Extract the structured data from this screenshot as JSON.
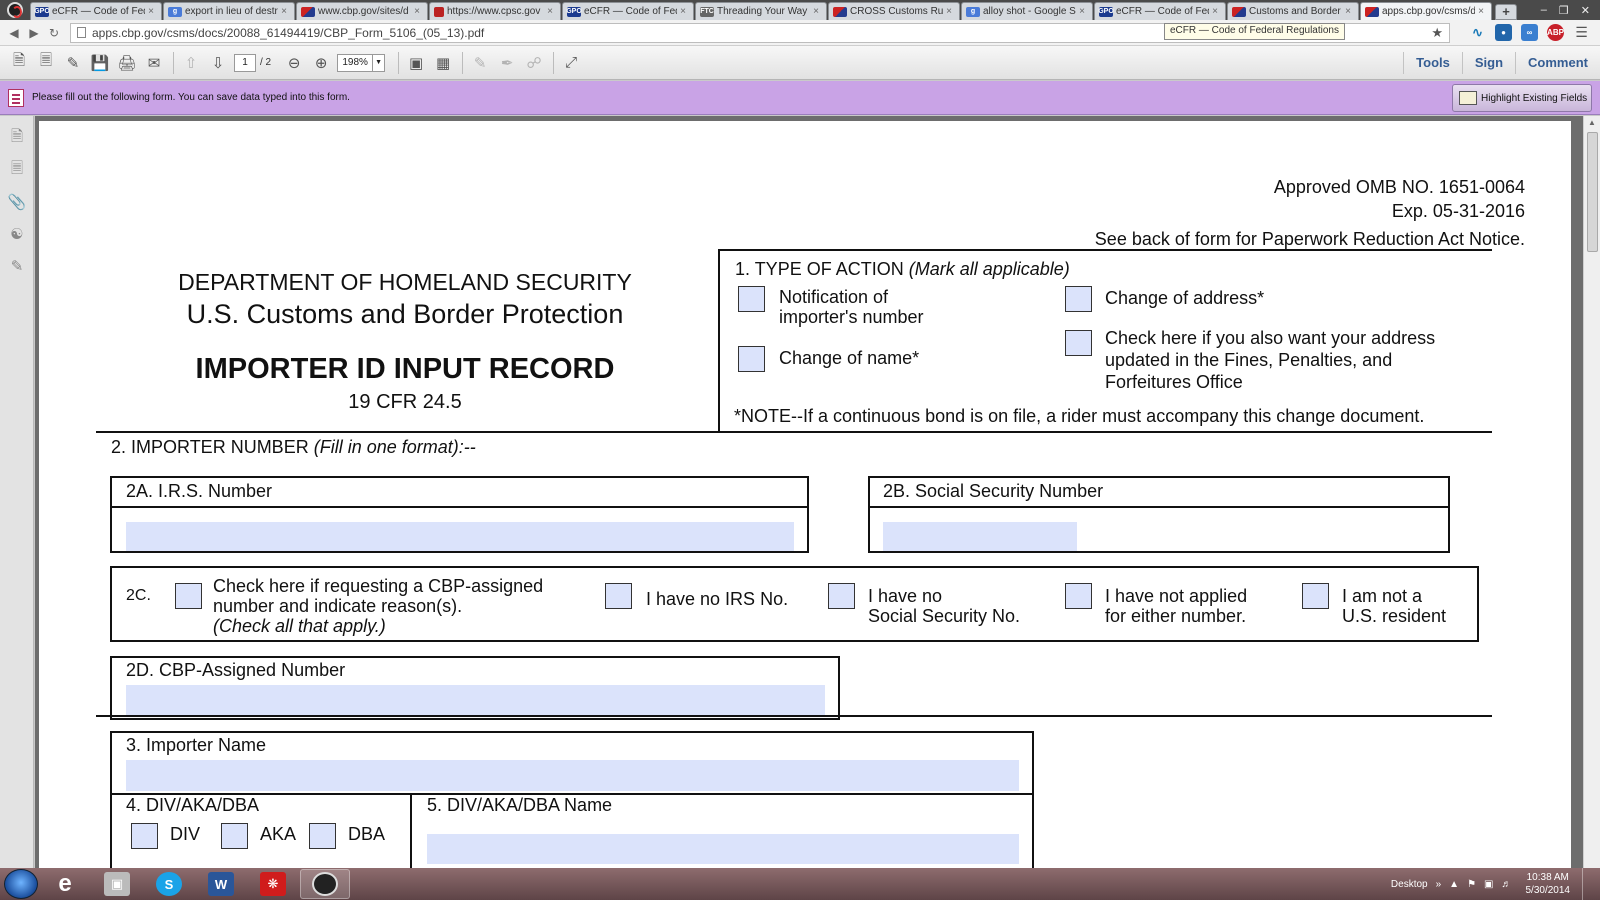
{
  "browser": {
    "tabs": [
      {
        "label": "eCFR — Code of Fed",
        "favicon": "gpo"
      },
      {
        "label": "export in lieu of destr",
        "favicon": "google"
      },
      {
        "label": "www.cbp.gov/sites/d",
        "favicon": "flag"
      },
      {
        "label": "https://www.cpsc.gov",
        "favicon": "cpsc"
      },
      {
        "label": "eCFR — Code of Fed",
        "favicon": "gpo"
      },
      {
        "label": "Threading Your Way",
        "favicon": "ftc"
      },
      {
        "label": "CROSS Customs Rulin",
        "favicon": "flag"
      },
      {
        "label": "alloy shot - Google S",
        "favicon": "google"
      },
      {
        "label": "eCFR — Code of Fed",
        "favicon": "gpo"
      },
      {
        "label": "Customs and Border",
        "favicon": "flag"
      },
      {
        "label": "apps.cbp.gov/csms/d",
        "favicon": "flag",
        "active": true
      }
    ],
    "url": "apps.cbp.gov/csms/docs/20088_61494419/CBP_Form_5106_(05_13).pdf",
    "hover_tooltip": "eCFR — Code of Federal Regulations"
  },
  "viewer": {
    "page_current": "1",
    "page_total": "/ 2",
    "zoom": "198%",
    "links": [
      "Tools",
      "Sign",
      "Comment"
    ],
    "form_notice": "Please fill out the following form. You can save data typed into this form.",
    "highlight_button": "Highlight Existing Fields"
  },
  "form": {
    "omb_line1": "Approved OMB NO. 1651-0064",
    "omb_line2": "Exp. 05-31-2016",
    "paperwork": "See back of form for Paperwork Reduction Act Notice.",
    "dept": "DEPARTMENT OF HOMELAND SECURITY",
    "agency": "U.S. Customs and Border Protection",
    "title": "IMPORTER ID INPUT RECORD",
    "cfr": "19 CFR 24.5",
    "s1_title": "1. TYPE OF ACTION",
    "s1_hint": "(Mark all applicable)",
    "s1_notify_1": "Notification of",
    "s1_notify_2": "importer's number",
    "s1_name": "Change of name*",
    "s1_address": "Change of address*",
    "s1_fpf_1": "Check here if you also want your address",
    "s1_fpf_2": "updated in the Fines, Penalties, and",
    "s1_fpf_3": "Forfeitures Office",
    "s1_note": "*NOTE--If a continuous bond is on file, a rider must accompany this change document.",
    "s2_title": "2. IMPORTER NUMBER",
    "s2_hint": "(Fill in one format):--",
    "s2a": "2A. I.R.S. Number",
    "s2b": "2B. Social Security Number",
    "s2c": "2C.",
    "s2c_req_1": "Check here if requesting a CBP-assigned",
    "s2c_req_2": "number and indicate reason(s).",
    "s2c_req_3": "(Check all that apply.)",
    "s2c_no_irs": "I have no IRS No.",
    "s2c_no_ssn_1": "I have no",
    "s2c_no_ssn_2": "Social Security No.",
    "s2c_not_applied_1": "I have not applied",
    "s2c_not_applied_2": "for either number.",
    "s2c_not_resident_1": "I am not a",
    "s2c_not_resident_2": "U.S. resident",
    "s2d": "2D. CBP-Assigned Number",
    "s3": "3. Importer Name",
    "s4": "4. DIV/AKA/DBA",
    "s4_div": "DIV",
    "s4_aka": "AKA",
    "s4_dba": "DBA",
    "s5": "5. DIV/AKA/DBA Name"
  },
  "taskbar": {
    "desktop_label": "Desktop",
    "time": "10:38 AM",
    "date": "5/30/2014"
  }
}
